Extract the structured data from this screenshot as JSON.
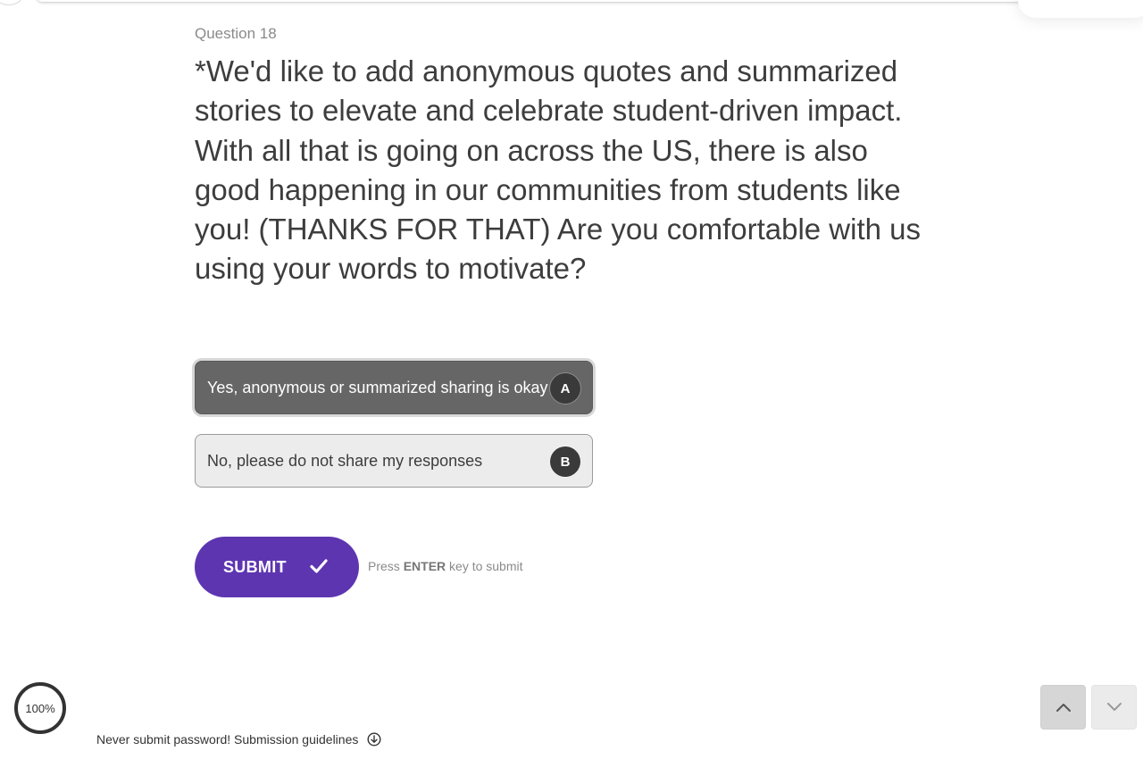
{
  "question": {
    "number_label": "Question 18",
    "text": "*We'd like to add anonymous quotes and summarized stories to elevate and celebrate student-driven impact. With all that is going on across the US, there is also good happening in our communities from students like you! (THANKS FOR THAT) Are you comfortable with us using your words to motivate?"
  },
  "choices": [
    {
      "label": "Yes, anonymous or summarized sharing is okay",
      "key": "A",
      "selected": true
    },
    {
      "label": "No, please do not share my responses",
      "key": "B",
      "selected": false
    }
  ],
  "submit": {
    "label": "SUBMIT",
    "hint_prefix": "Press",
    "hint_key": "ENTER",
    "hint_suffix": "key to submit",
    "color": "#5e35b1"
  },
  "progress": {
    "label": "100%",
    "value": 1.0
  },
  "footer": {
    "note": "Never submit password! Submission guidelines",
    "icon": "arrow-down-circle-icon"
  },
  "navigation": {
    "up_icon": "chevron-up-icon",
    "down_icon": "chevron-down-icon"
  }
}
